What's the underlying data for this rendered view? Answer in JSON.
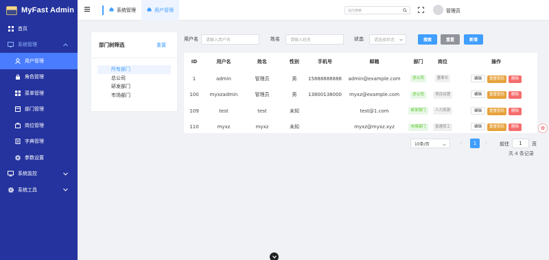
{
  "app": {
    "title": "MyFast Admin"
  },
  "sidebar": {
    "items": [
      {
        "label": "首页",
        "icon": "dashboard-icon"
      },
      {
        "label": "系统管理",
        "icon": "settings-icon"
      },
      {
        "label": "系统监控",
        "icon": "monitor-icon"
      },
      {
        "label": "系统工具",
        "icon": "tools-icon"
      }
    ],
    "sub_items": [
      {
        "label": "用户管理",
        "icon": "user-icon"
      },
      {
        "label": "角色管理",
        "icon": "lock-icon"
      },
      {
        "label": "菜单管理",
        "icon": "grid-icon"
      },
      {
        "label": "部门管理",
        "icon": "org-icon"
      },
      {
        "label": "岗位管理",
        "icon": "post-icon"
      },
      {
        "label": "字典管理",
        "icon": "book-icon"
      },
      {
        "label": "参数设置",
        "icon": "gear-icon"
      }
    ]
  },
  "header": {
    "breadcrumb": [
      "系统管理",
      "用户管理"
    ],
    "search_placeholder": "站内搜索",
    "username": "管理员"
  },
  "tree": {
    "title": "部门树筛选",
    "reset": "重置",
    "nodes": [
      "所有部门",
      "总公司",
      "研发部门",
      "市场部门"
    ]
  },
  "filters": {
    "username_label": "用户名",
    "username_placeholder": "请输入用户名",
    "name_label": "姓名",
    "name_placeholder": "请输入姓名",
    "status_label": "状态",
    "status_placeholder": "请选择状态",
    "search_btn": "搜索",
    "reset_btn": "重置",
    "add_btn": "新增"
  },
  "table": {
    "columns": [
      "ID",
      "用户名",
      "姓名",
      "性别",
      "手机号",
      "邮箱",
      "部门",
      "岗位",
      "操作"
    ],
    "rows": [
      {
        "id": "1",
        "username": "admin",
        "name": "管理员",
        "gender": "男",
        "phone": "15888888888",
        "email": "admin@example.com",
        "dept": "总公司",
        "post": "董事长"
      },
      {
        "id": "100",
        "username": "myxzadmin",
        "name": "管理员",
        "gender": "男",
        "phone": "13800138000",
        "email": "myxz@example.com",
        "dept": "总公司",
        "post": "项目经理"
      },
      {
        "id": "109",
        "username": "test",
        "name": "test",
        "gender": "未知",
        "phone": "",
        "email": "test@1.com",
        "dept": "研发部门",
        "post": "人力资源"
      },
      {
        "id": "110",
        "username": "myxz",
        "name": "myxz",
        "gender": "未知",
        "phone": "",
        "email": "myxz@myxz.xyz",
        "dept": "市场部门",
        "post": "普通员工"
      }
    ],
    "actions": {
      "edit": "编辑",
      "reset_pw": "重置密码",
      "delete": "删除"
    }
  },
  "pagination": {
    "page_size": "10条/页",
    "current_page": "1",
    "goto_label": "前往",
    "goto_value": "1",
    "goto_unit": "页",
    "total": "共 4 条记录"
  },
  "colors": {
    "sidebar": "#24339e",
    "active": "#4a7cff",
    "primary": "#409eff",
    "warning": "#e6a23c",
    "danger": "#f56c6c"
  }
}
